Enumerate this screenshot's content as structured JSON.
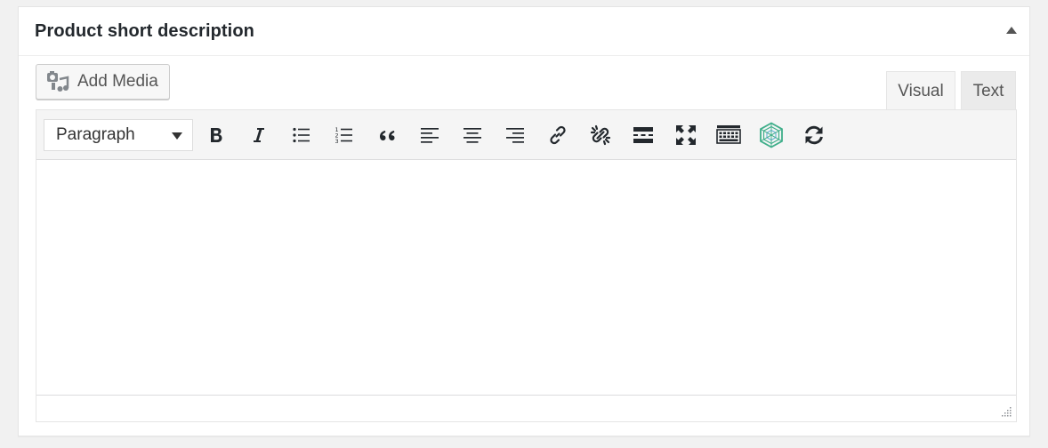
{
  "postbox": {
    "title": "Product short description"
  },
  "media": {
    "add_media_label": "Add Media"
  },
  "tabs": [
    {
      "label": "Visual",
      "active": true
    },
    {
      "label": "Text",
      "active": false
    }
  ],
  "toolbar": {
    "format_select": {
      "value": "Paragraph"
    },
    "buttons": [
      {
        "icon": "bold-icon"
      },
      {
        "icon": "italic-icon"
      },
      {
        "icon": "bullet-list-icon"
      },
      {
        "icon": "numbered-list-icon"
      },
      {
        "icon": "blockquote-icon"
      },
      {
        "icon": "align-left-icon"
      },
      {
        "icon": "align-center-icon"
      },
      {
        "icon": "align-right-icon"
      },
      {
        "icon": "insert-link-icon"
      },
      {
        "icon": "remove-link-icon"
      },
      {
        "icon": "read-more-tag-icon"
      },
      {
        "icon": "fullscreen-icon"
      },
      {
        "icon": "toolbar-toggle-icon"
      },
      {
        "icon": "plugin-cube-icon"
      },
      {
        "icon": "refresh-icon"
      }
    ]
  },
  "colors": {
    "icon": "#23282d",
    "plugin_icon": "#3fae8a"
  }
}
